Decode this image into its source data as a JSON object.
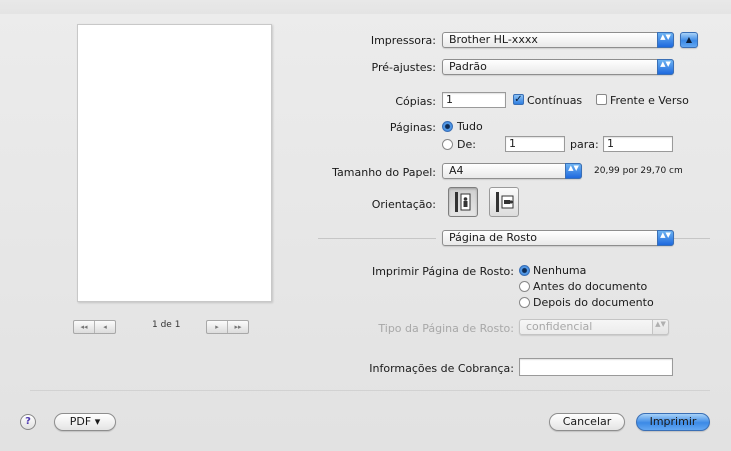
{
  "preview": {
    "page_counter": "1 de 1",
    "nav_first": "◂◂",
    "nav_prev": "◂",
    "nav_next": "▸",
    "nav_last": "▸▸"
  },
  "printer": {
    "label": "Impressora:",
    "value": "Brother HL-xxxx",
    "toggle_glyph": "▲"
  },
  "presets": {
    "label": "Pré-ajustes:",
    "value": "Padrão"
  },
  "copies": {
    "label": "Cópias:",
    "value": "1",
    "collated_label": "Contínuas",
    "collated_checked": true,
    "duplex_label": "Frente e Verso",
    "duplex_checked": false
  },
  "pages": {
    "label": "Páginas:",
    "all_label": "Tudo",
    "all_selected": true,
    "from_label": "De:",
    "from_value": "1",
    "to_label": "para:",
    "to_value": "1"
  },
  "paper_size": {
    "label": "Tamanho do Papel:",
    "value": "A4",
    "dimensions": "20,99 por 29,70 cm"
  },
  "orientation": {
    "label": "Orientação:",
    "selected": "portrait"
  },
  "section": {
    "value": "Página de Rosto"
  },
  "cover_page": {
    "label": "Imprimir Página de Rosto:",
    "options": [
      "Nenhuma",
      "Antes do documento",
      "Depois do documento"
    ],
    "selected_index": 0
  },
  "cover_type": {
    "label": "Tipo da Página de Rosto:",
    "value": "confidencial",
    "enabled": false
  },
  "billing": {
    "label": "Informações de Cobrança:",
    "value": ""
  },
  "footer": {
    "help_glyph": "?",
    "pdf_label": "PDF ▾",
    "cancel_label": "Cancelar",
    "print_label": "Imprimir"
  },
  "popup_arrows_glyph": "▲▼",
  "checkmark_glyph": "✓"
}
